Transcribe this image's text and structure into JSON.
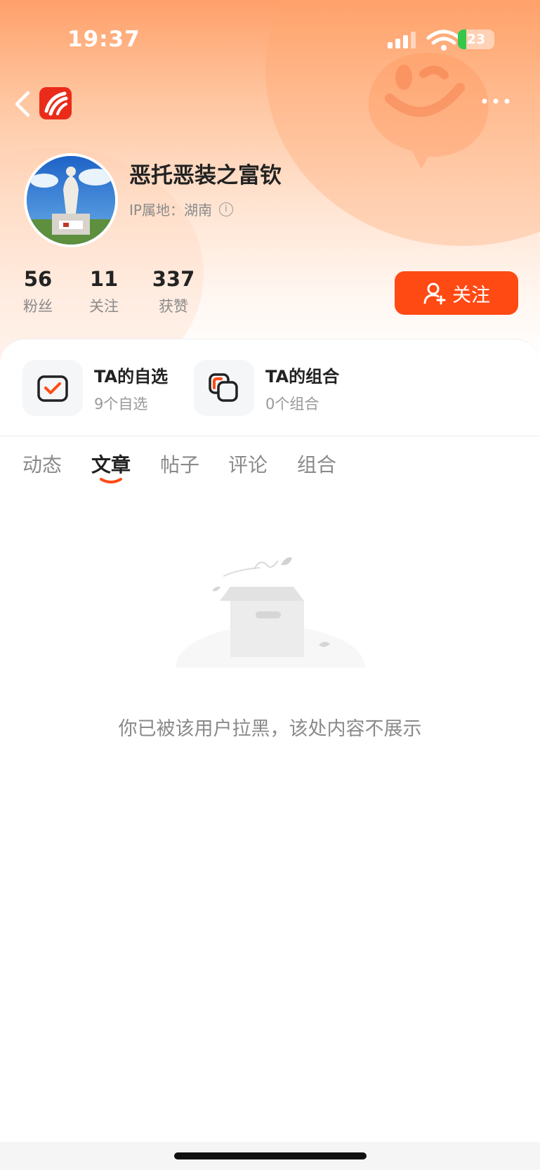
{
  "status_bar": {
    "time": "19:37",
    "battery": "23",
    "battery_level_percent": 23
  },
  "nav": {
    "back_icon": "chevron-left-icon",
    "logo_icon": "app-logo-icon",
    "more_icon": "more-dots-icon"
  },
  "profile": {
    "name": "恶托恶装之富钦",
    "ip_location": "IP属地：湖南",
    "info_icon": "info-icon"
  },
  "stats": [
    {
      "value": "56",
      "label": "粉丝"
    },
    {
      "value": "11",
      "label": "关注"
    },
    {
      "value": "337",
      "label": "获赞"
    }
  ],
  "follow_button": {
    "label": "关注",
    "icon": "add-user-icon"
  },
  "quick_links": [
    {
      "title": "TA的自选",
      "subtitle": "9个自选",
      "icon": "checkbox-icon"
    },
    {
      "title": "TA的组合",
      "subtitle": "0个组合",
      "icon": "portfolio-icon"
    }
  ],
  "tabs": [
    "动态",
    "文章",
    "帖子",
    "评论",
    "组合"
  ],
  "active_tab": "文章",
  "empty_state": {
    "message": "你已被该用户拉黑，该处内容不展示",
    "illustration": "empty-box-icon"
  },
  "colors": {
    "accent": "#ff4a14",
    "header_gradient_top": "#ffa06a",
    "battery_green": "#36c64a"
  }
}
